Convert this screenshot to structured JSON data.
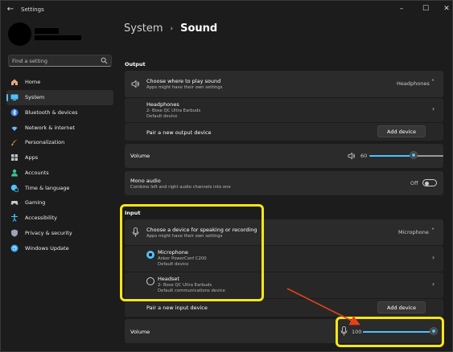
{
  "app": {
    "title": "Settings"
  },
  "window_controls": {
    "minimize": "–",
    "maximize": "☐",
    "close": "✕"
  },
  "search": {
    "placeholder": "Find a setting"
  },
  "sidebar": {
    "items": [
      {
        "label": "Home",
        "icon": "home-icon",
        "color": "#e8a87c"
      },
      {
        "label": "System",
        "icon": "system-icon",
        "color": "#4cc2ff",
        "active": true
      },
      {
        "label": "Bluetooth & devices",
        "icon": "bluetooth-icon",
        "color": "#4c9bff"
      },
      {
        "label": "Network & internet",
        "icon": "network-icon",
        "color": "#6fb6ff"
      },
      {
        "label": "Personalization",
        "icon": "brush-icon",
        "color": "#e39a4a"
      },
      {
        "label": "Apps",
        "icon": "apps-icon",
        "color": "#c3c3c3"
      },
      {
        "label": "Accounts",
        "icon": "accounts-icon",
        "color": "#3ec28f"
      },
      {
        "label": "Time & language",
        "icon": "globe-clock-icon",
        "color": "#4cc2ff"
      },
      {
        "label": "Gaming",
        "icon": "gaming-icon",
        "color": "#c8c8c8"
      },
      {
        "label": "Accessibility",
        "icon": "accessibility-icon",
        "color": "#4cc2ff"
      },
      {
        "label": "Privacy & security",
        "icon": "shield-icon",
        "color": "#9aa4b4"
      },
      {
        "label": "Windows Update",
        "icon": "update-icon",
        "color": "#3fa9f5"
      }
    ]
  },
  "breadcrumb": {
    "parent": "System",
    "separator": "›",
    "current": "Sound"
  },
  "output": {
    "section_label": "Output",
    "choose": {
      "title": "Choose where to play sound",
      "subtitle": "Apps might have their own settings",
      "value": "Headphones"
    },
    "device": {
      "name": "Headphones",
      "line1": "2- Bose QC Ultra Earbuds",
      "line2": "Default device"
    },
    "pair": {
      "label": "Pair a new output device",
      "button": "Add device"
    },
    "volume": {
      "label": "Volume",
      "value": "60",
      "level": 0.6
    },
    "mono": {
      "title": "Mono audio",
      "subtitle": "Combine left and right audio channels into one",
      "state": "Off"
    }
  },
  "input": {
    "section_label": "Input",
    "choose": {
      "title": "Choose a device for speaking or recording",
      "subtitle": "Apps might have their own settings",
      "value": "Microphone"
    },
    "devices": [
      {
        "name": "Microphone",
        "line1": "Anker PowerConf C200",
        "line2": "Default device",
        "selected": true
      },
      {
        "name": "Headset",
        "line1": "2- Bose QC Ultra Earbuds",
        "line2": "Default communications device",
        "selected": false
      }
    ],
    "pair": {
      "label": "Pair a new input device",
      "button": "Add device"
    },
    "volume": {
      "label": "Volume",
      "value": "100",
      "level": 1.0
    }
  },
  "colors": {
    "accent": "#4cc2ff",
    "highlight": "#f7e51a",
    "arrow": "#e8401c"
  }
}
